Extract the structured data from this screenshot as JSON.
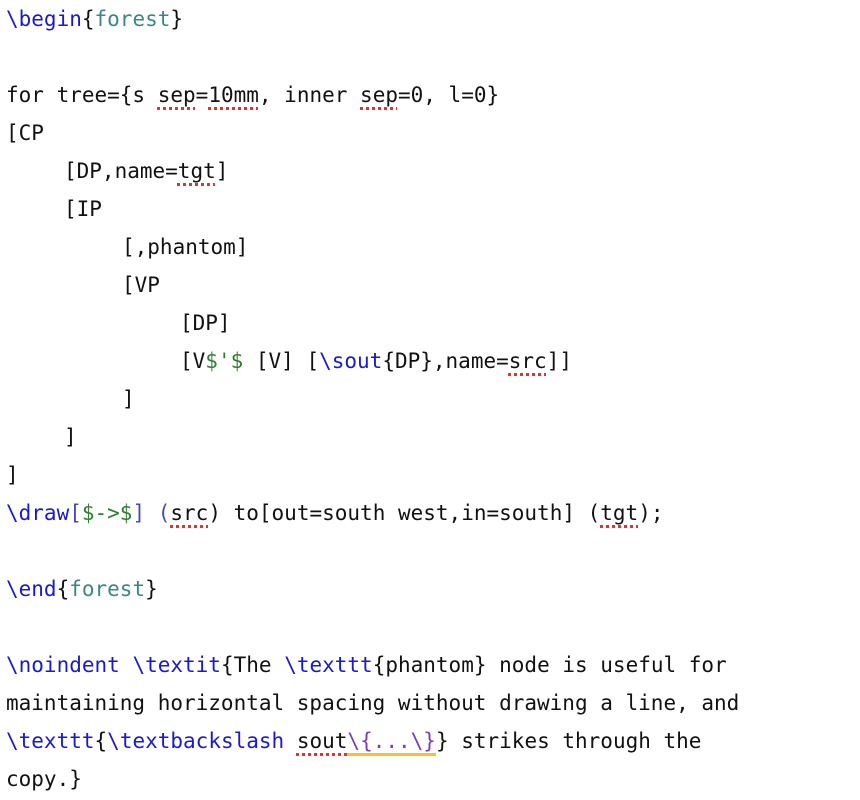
{
  "lines": [
    [
      "\\begin",
      "{",
      "forest",
      "}"
    ],
    [],
    [
      "for tree={s ",
      "sep",
      "=",
      "10mm",
      ", inner ",
      "sep",
      "=0, l=0}"
    ],
    [
      "[CP"
    ],
    [
      "[DP,name=",
      "tgt",
      "]"
    ],
    [
      "[IP"
    ],
    [
      "[,phantom]"
    ],
    [
      "[VP"
    ],
    [
      "[DP]"
    ],
    [
      "[V",
      "$'$",
      " [V] [",
      "\\sout",
      "{DP},name=",
      "src",
      "]]"
    ],
    [
      "]"
    ],
    [
      "]"
    ],
    [
      "]"
    ],
    [
      "\\draw",
      "[",
      "$->$",
      "] (",
      "src",
      ") to[out=south west,in=south] (",
      "tgt",
      ");"
    ],
    [],
    [
      "\\end",
      "{",
      "forest",
      "}"
    ],
    [],
    [
      "\\noindent",
      " ",
      "\\textit",
      "{The ",
      "\\texttt",
      "{phantom} node is useful for"
    ],
    [
      "maintaining horizontal spacing without drawing a line, and"
    ],
    [
      "\\texttt",
      "{",
      "\\textbackslash",
      " ",
      "sout",
      "\\{...\\}",
      "} strikes through the"
    ],
    [
      "copy.}"
    ]
  ]
}
